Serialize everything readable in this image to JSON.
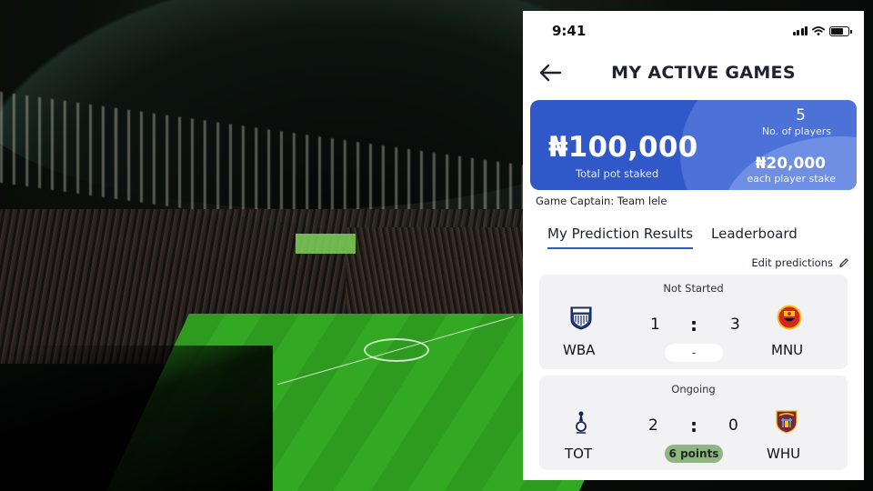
{
  "status_bar": {
    "time": "9:41"
  },
  "header": {
    "title": "MY ACTIVE GAMES"
  },
  "pot": {
    "total_amount": "₦100,000",
    "total_label": "Total pot staked",
    "players_count": "5",
    "players_label": "No. of players",
    "stake_amount": "₦20,000",
    "stake_label": "each player stake"
  },
  "captain": "Game Captain: Team lele",
  "tabs": [
    {
      "label": "My Prediction Results",
      "active": true
    },
    {
      "label": "Leaderboard",
      "active": false
    }
  ],
  "edit_predictions": "Edit predictions",
  "matches": [
    {
      "status": "Not Started",
      "home": {
        "name": "WBA",
        "score": "1",
        "crest": "wba-crest-icon"
      },
      "away": {
        "name": "MNU",
        "score": "3",
        "crest": "man-utd-crest-icon"
      },
      "separator": ":",
      "result": "-"
    },
    {
      "status": "Ongoing",
      "home": {
        "name": "TOT",
        "score": "2",
        "crest": "tottenham-crest-icon"
      },
      "away": {
        "name": "WHU",
        "score": "0",
        "crest": "west-ham-crest-icon"
      },
      "separator": ":",
      "result": "6 points"
    }
  ],
  "colors": {
    "accent": "#3058c8",
    "points_pill": "#8fb585",
    "card_bg": "#f2f2f4"
  }
}
